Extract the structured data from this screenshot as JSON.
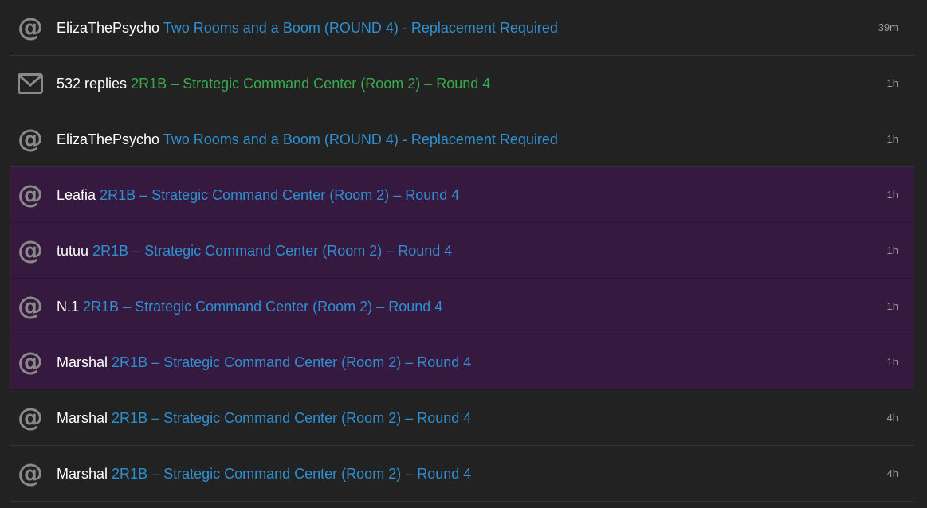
{
  "notifications": [
    {
      "type": "mention",
      "icon": "at-icon",
      "user": "ElizaThePsycho",
      "topic": "Two Rooms and a Boom (ROUND 4) - Replacement Required",
      "time": "39m",
      "unread": false
    },
    {
      "type": "replies",
      "icon": "envelope-icon",
      "user": "532 replies",
      "topic": "2R1B – Strategic Command Center (Room 2) – Round 4",
      "time": "1h",
      "unread": false
    },
    {
      "type": "mention",
      "icon": "at-icon",
      "user": "ElizaThePsycho",
      "topic": "Two Rooms and a Boom (ROUND 4) - Replacement Required",
      "time": "1h",
      "unread": false
    },
    {
      "type": "mention",
      "icon": "at-icon",
      "user": "Leafia",
      "topic": "2R1B – Strategic Command Center (Room 2) – Round 4",
      "time": "1h",
      "unread": true
    },
    {
      "type": "mention",
      "icon": "at-icon",
      "user": "tutuu",
      "topic": "2R1B – Strategic Command Center (Room 2) – Round 4",
      "time": "1h",
      "unread": true
    },
    {
      "type": "mention",
      "icon": "at-icon",
      "user": "N.1",
      "topic": "2R1B – Strategic Command Center (Room 2) – Round 4",
      "time": "1h",
      "unread": true
    },
    {
      "type": "mention",
      "icon": "at-icon",
      "user": "Marshal",
      "topic": "2R1B – Strategic Command Center (Room 2) – Round 4",
      "time": "1h",
      "unread": true
    },
    {
      "type": "mention",
      "icon": "at-icon",
      "user": "Marshal",
      "topic": "2R1B – Strategic Command Center (Room 2) – Round 4",
      "time": "4h",
      "unread": false
    },
    {
      "type": "mention",
      "icon": "at-icon",
      "user": "Marshal",
      "topic": "2R1B – Strategic Command Center (Room 2) – Round 4",
      "time": "4h",
      "unread": false
    }
  ],
  "colors": {
    "background": "#222222",
    "unread_background": "#35193f",
    "link": "#2f8fd0",
    "replies_link": "#3aaa4e",
    "icon": "#8a8a8a"
  }
}
